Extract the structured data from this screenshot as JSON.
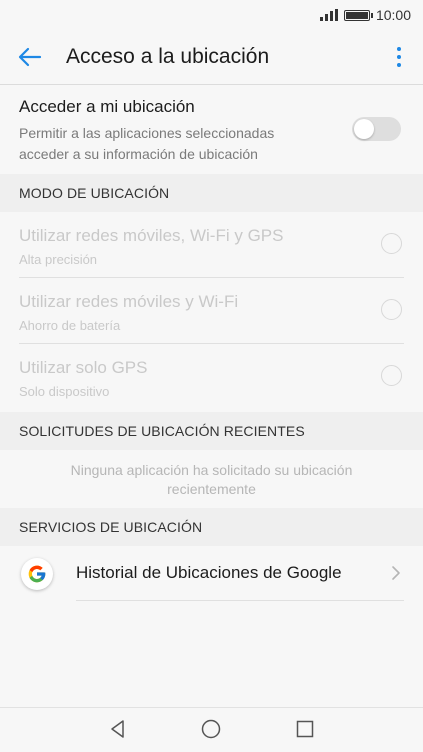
{
  "status_bar": {
    "time": "10:00",
    "signal_icon": "signal-icon",
    "battery_icon": "battery-icon"
  },
  "app_bar": {
    "title": "Acceso a la ubicación",
    "back_icon": "back-arrow-icon",
    "menu_icon": "more-vert-icon",
    "accent_color": "#1e88e5"
  },
  "location_toggle": {
    "title": "Acceder a mi ubicación",
    "description": "Permitir a las aplicaciones seleccionadas acceder a su información de ubicación",
    "enabled": false
  },
  "location_mode": {
    "header": "MODO DE UBICACIÓN",
    "options": [
      {
        "title": "Utilizar redes móviles, Wi-Fi y GPS",
        "subtitle": "Alta precisión",
        "selected": false
      },
      {
        "title": "Utilizar redes móviles y Wi-Fi",
        "subtitle": "Ahorro de batería",
        "selected": false
      },
      {
        "title": "Utilizar solo GPS",
        "subtitle": "Solo dispositivo",
        "selected": false
      }
    ]
  },
  "recent_requests": {
    "header": "SOLICITUDES DE UBICACIÓN RECIENTES",
    "empty_message": "Ninguna aplicación ha solicitado su ubicación recientemente"
  },
  "location_services": {
    "header": "SERVICIOS DE UBICACIÓN",
    "items": [
      {
        "label": "Historial de Ubicaciones de Google",
        "icon": "google-logo-icon"
      }
    ]
  },
  "nav_bar": {
    "back_icon": "nav-back-icon",
    "home_icon": "nav-home-icon",
    "recents_icon": "nav-recents-icon"
  }
}
